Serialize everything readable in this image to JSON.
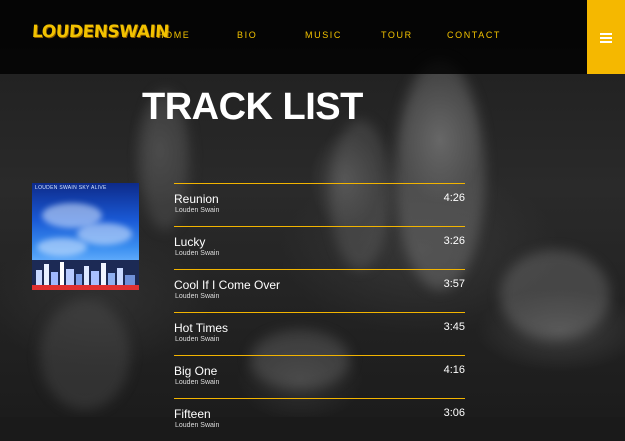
{
  "header": {
    "logo_text": "LOUDENSWAIN",
    "nav": [
      {
        "label": "HOME"
      },
      {
        "label": "BIO"
      },
      {
        "label": "MUSIC"
      },
      {
        "label": "TOUR"
      },
      {
        "label": "CONTACT"
      }
    ],
    "menu_icon": "hamburger-icon"
  },
  "colors": {
    "accent": "#f2c200",
    "menu_button": "#f5b800",
    "header_bg": "#000000"
  },
  "page": {
    "title": "TRACK LIST"
  },
  "album": {
    "cover_text": "LOUDEN SWAIN SKY ALIVE"
  },
  "tracks": [
    {
      "name": "Reunion",
      "artist": "Louden Swain",
      "duration": "4:26"
    },
    {
      "name": "Lucky",
      "artist": "Louden Swain",
      "duration": "3:26"
    },
    {
      "name": "Cool If I Come Over",
      "artist": "Louden Swain",
      "duration": "3:57"
    },
    {
      "name": "Hot Times",
      "artist": "Louden Swain",
      "duration": "3:45"
    },
    {
      "name": "Big One",
      "artist": "Louden Swain",
      "duration": "4:16"
    },
    {
      "name": "Fifteen",
      "artist": "Louden Swain",
      "duration": "3:06"
    }
  ]
}
